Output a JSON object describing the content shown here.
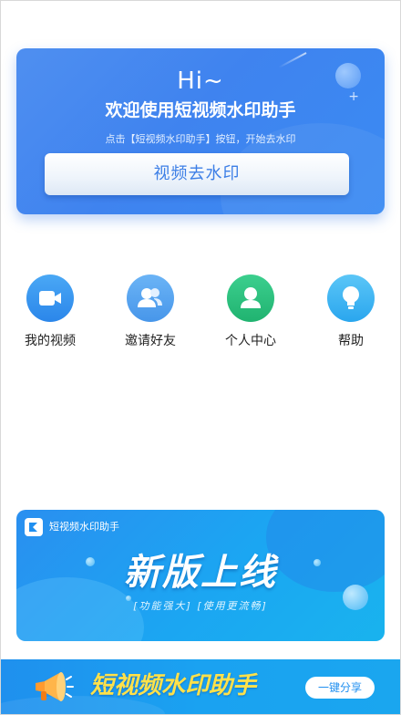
{
  "hero": {
    "greeting": "Hi~",
    "welcome": "欢迎使用短视频水印助手",
    "hint": "点击【短视频水印助手】按钮，开始去水印",
    "cta_label": "视频去水印"
  },
  "menu": {
    "items": [
      {
        "label": "我的视频",
        "icon": "video-camera-icon",
        "color": "#2b86ea"
      },
      {
        "label": "邀请好友",
        "icon": "friends-icon",
        "color": "#4796ea"
      },
      {
        "label": "个人中心",
        "icon": "person-icon",
        "color": "#20b370"
      },
      {
        "label": "帮助",
        "icon": "lightbulb-icon",
        "color": "#2aa6ee"
      }
    ]
  },
  "banner": {
    "brand": "短视频水印助手",
    "headline": "新版上线",
    "tagline": "[功能强大] [使用更流畅]"
  },
  "bottom_bar": {
    "title": "短视频水印助手",
    "share_label": "一键分享",
    "title_color": "#ffe14a"
  }
}
